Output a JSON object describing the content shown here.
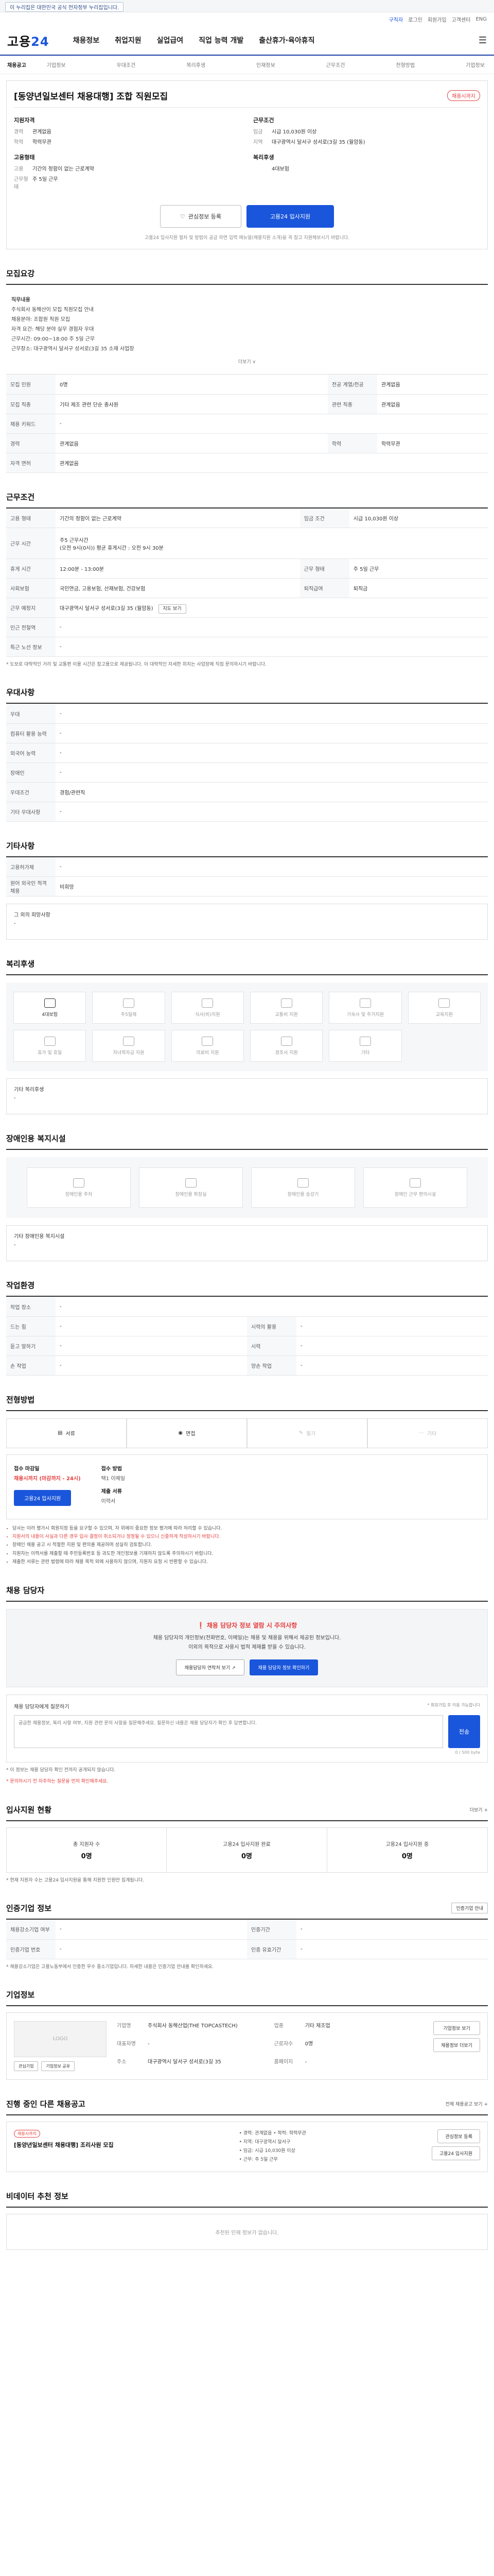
{
  "topbar": {
    "notice": "이 누리집은 대한민국 공식 전자정부 누리집입니다."
  },
  "util": {
    "items": [
      "로그인",
      "회원가입",
      "고객센터",
      "ENG"
    ],
    "highlight": "구직자"
  },
  "header": {
    "logo_main": "고용",
    "logo_accent": "24",
    "menu": [
      "채용정보",
      "취업지원",
      "실업급여",
      "직업 능력 개발",
      "출산휴가·육아휴직"
    ],
    "menu_icon": "☰"
  },
  "subnav": {
    "first": "채용공고",
    "items": [
      "기업정보",
      "우대조건",
      "복리후생",
      "인재정보",
      "근무조건",
      "전형방법",
      "기업정보"
    ]
  },
  "job": {
    "title": "[동양년일보센터 채용대행] 조합 직원모집",
    "status": "채용시까지",
    "summary": {
      "left_title": "지원자격",
      "left_rows": [
        [
          "경력",
          "관계없음"
        ],
        [
          "학력",
          "학력무관"
        ]
      ],
      "left2_title": "고용형태",
      "left2_rows": [
        [
          "고용",
          "기간의 정함이 없는 근로계약"
        ],
        [
          "근무형태",
          "주 5일 근무"
        ]
      ],
      "right_title": "근무조건",
      "right_rows": [
        [
          "임금",
          "시급 10,030원 이상"
        ],
        [
          "지역",
          "대구광역시 달서구 성서로(3길 35 (월암동)"
        ]
      ],
      "right2_title": "복리후생",
      "right2_rows": [
        [
          "",
          "4대보험"
        ]
      ]
    },
    "btn_scrap": "관심정보 등록",
    "btn_apply": "고용24 입사지원",
    "notice": "고용24 입사지원 절차 및 방법이 궁금 하면 입력 메뉴얼(채용지원 소개)을 꼭 참고 지원해보시기 바랍니다."
  },
  "sections": {
    "recruit": "모집요강",
    "work": "근무조건",
    "pref": "우대사항",
    "etc": "기타사항",
    "benefit": "복리후생",
    "disability": "장애인용 복지시설",
    "environment": "작업환경",
    "method": "전형방법",
    "contact": "채용 담당자",
    "stats": "입사지원 현황",
    "auth": "인증기업 정보",
    "company": "기업정보",
    "related": "진행 중인 다른 채용공고",
    "talent": "비데이터 추천 정보"
  },
  "recruit": {
    "desc_lines": [
      "직무내용",
      "주식회사 동해산이 모집 직원모집 안내",
      "채용분야: 조합원 직원 모집",
      "자격 요건: 해당 분야 실무 경험자 우대",
      "근무시간: 09:00~18:00 주 5일 근무",
      "근무장소: 대구광역시 달서구 성서로(3길 35 소재 사업장"
    ],
    "more": "더보기 ∨",
    "rows": [
      [
        [
          "모집 인원",
          "0명"
        ],
        [
          "전공 계열/전공",
          "관계없음"
        ]
      ],
      [
        [
          "모집 직종",
          "기타 제조 관련 단순 종사원"
        ],
        [
          "관련 직종",
          "관계없음"
        ]
      ],
      [
        [
          "채용 키워드",
          "-"
        ],
        [
          "",
          ""
        ]
      ],
      [
        [
          "경력",
          "관계없음"
        ],
        [
          "학력",
          "학력무관"
        ]
      ],
      [
        [
          "자격 면허",
          "관계없음"
        ],
        [
          "",
          ""
        ]
      ]
    ]
  },
  "work": {
    "rows": [
      [
        [
          "고용 형태",
          "기간의 정함이 없는 근로계약"
        ],
        [
          "임금 조건",
          "시급 10,030원 이상"
        ]
      ],
      [
        [
          "근무 시간",
          "주5 근무시간\n(오전 9시(0시)) 평균 휴게시간 : 오전 9시 30분"
        ],
        [
          "",
          ""
        ]
      ],
      [
        [
          "휴게 시간",
          "12:00분 - 13:00분"
        ],
        [
          "근무 형태",
          "주 5일 근무"
        ]
      ],
      [
        [
          "사회보험",
          "국민연금, 고용보험, 산재보험, 건강보험"
        ],
        [
          "퇴직급여",
          "퇴직금"
        ]
      ],
      [
        [
          "근무 예정지",
          "대구광역시 달서구 성서로(3길 35 (월암동)"
        ],
        [
          "",
          ""
        ]
      ],
      [
        [
          "인근 전철역",
          "-"
        ],
        [
          "",
          ""
        ]
      ],
      [
        [
          "특근 노선 정보",
          "-"
        ],
        [
          "",
          ""
        ]
      ]
    ],
    "map_btn": "지도 보기",
    "note": "* 도보로 대략적인 거리 및 교통편 이용 시간은 참고용으로 제공됩니다. 이 대략적인 자세한 위치는 사업장에 직접 문의하시기 바랍니다."
  },
  "pref": {
    "rows": [
      [
        "우대",
        "-"
      ],
      [
        "컴퓨터 활용 능력",
        "-"
      ],
      [
        "외국어 능력",
        "-"
      ],
      [
        "장애인",
        "-"
      ],
      [
        "우대조건",
        "경험/관련직"
      ],
      [
        "기타 우대사항",
        "-"
      ]
    ]
  },
  "etc": {
    "rows": [
      [
        "고용허가제",
        "-"
      ],
      [
        "원어 외국인 적격 채용",
        "비희망"
      ]
    ],
    "note_title": "그 외의 희망사항",
    "note_value": "-"
  },
  "benefit": {
    "items": [
      {
        "label": "4대보험",
        "on": true
      },
      {
        "label": "주5일제",
        "on": false
      },
      {
        "label": "식사(비)지원",
        "on": false
      },
      {
        "label": "교통비 지원",
        "on": false
      },
      {
        "label": "기숙사 및 주거지원",
        "on": false
      },
      {
        "label": "교육지원",
        "on": false
      },
      {
        "label": "휴가 및 휴일",
        "on": false
      },
      {
        "label": "자녀학자금 지원",
        "on": false
      },
      {
        "label": "의료비 지원",
        "on": false
      },
      {
        "label": "경조사 지원",
        "on": false
      },
      {
        "label": "기타",
        "on": false
      }
    ],
    "note_title": "기타 복리후생",
    "note_value": "-"
  },
  "disability": {
    "items": [
      "장애인용 주차",
      "장애인용 화장실",
      "장애인용 승강기",
      "장애인 근무 편의시설"
    ],
    "note_title": "기타 장애인용 복지시설",
    "note_value": "-"
  },
  "environment": {
    "rows": [
      [
        [
          "작업 장소",
          "-"
        ],
        [
          "",
          ""
        ]
      ],
      [
        [
          "드는 힘",
          "-"
        ],
        [
          "시력의 활용",
          "-"
        ]
      ],
      [
        [
          "듣고 말하기",
          "-"
        ],
        [
          "시력",
          "-"
        ]
      ],
      [
        [
          "손 작업",
          "-"
        ],
        [
          "양손 작업",
          "-"
        ]
      ]
    ]
  },
  "method": {
    "items": [
      {
        "label": "서류",
        "on": true
      },
      {
        "label": "면접",
        "on": true
      },
      {
        "label": "필기",
        "on": false
      },
      {
        "label": "기타",
        "on": false
      }
    ],
    "apply_title": "접수 마감일",
    "apply_value": "채용시까지 (마감까지 - 24시)",
    "apply_method_title": "접수 방법",
    "apply_method": "택1 이메일",
    "apply_doc_title": "제출 서류",
    "apply_doc": "이력서",
    "apply_btn": "고용24 입사지원",
    "bullets": [
      "당사는 이러 평가시 회원지정 등을 요구할 수 있으며, 자 위에이 중요한 정보 평가에 따라 처리할 수 있습니다.",
      "지원서의 내용이 사실과 다른 경우 입사 결정이 취소되거나 정정될 수 있으니 신중하게 작성하시기 바랍니다.",
      "장애인 채용 공고 시 적절한 지원 및 편의를 제공하며 성실히 검토합니다.",
      "지원자는 이력서를 제출할 때 주민등록번호 등 과도한 개인정보를 기재하지 않도록 주의하시기 바랍니다.",
      "제출한 서류는 관련 법령에 따라 채용 목적 외에 사용하지 않으며, 지원자 요청 시 반환할 수 있습니다."
    ]
  },
  "contact": {
    "banner_title": "❗ 채용 담당자 정보 열람 시 주의사항",
    "banner_text": "채용 담당자의 개인정보(전화번호, 이메일)는 채용 및 채용을 위해서 제공된 정보입니다.\n이외의 목적으로 사용시 법적 제재를 받을 수 있습니다.",
    "btn_view": "채용담당자 연락처 보기 ↗",
    "btn_confirm": "채용 담당자 정보 확인하기",
    "inquiry_title": "채용 담당자에게 질문하기",
    "inquiry_right": "* 회원가입 후 이용 가능합니다",
    "inquiry_placeholder": "궁금한 채용정보, 복리 사항 여부, 지원 관련 문의 사항을 질문해주세요. 질문하신 내용은 채용 담당자가 확인 후 답변합니다.",
    "inquiry_btn": "전송",
    "inquiry_count": "0 / 500 byte",
    "bullets": [
      "* 이 정보는 채용 담당자 확인 전까지 공개되지 않습니다.",
      "* 문의하시기 전 자주하는 질문을 먼저 확인해주세요."
    ]
  },
  "stats": {
    "right": "더보기 +",
    "items": [
      {
        "label": "총 지원자 수",
        "value": "0명"
      },
      {
        "label": "고용24 입사지원 완료",
        "value": "0명"
      },
      {
        "label": "고용24 입사지원 중",
        "value": "0명"
      }
    ],
    "note": "* 현재 지원자 수는 고용24 입사지원을 통해 지원한 인원만 집계됩니다."
  },
  "auth": {
    "right": "인증기업 안내",
    "rows": [
      [
        [
          "채용강소기업 여부",
          "-"
        ],
        [
          "인증기간",
          "-"
        ]
      ],
      [
        [
          "인증기업 번호",
          "-"
        ],
        [
          "인증 유효기간",
          "-"
        ]
      ]
    ],
    "note": "* 채용강소기업은 고용노동부에서 인증한 우수 중소기업입니다. 자세한 내용은 인증기업 안내를 확인하세요."
  },
  "company": {
    "logo_text": "LOGO",
    "mini_btns": [
      "관심기업",
      "기업정보 공유"
    ],
    "rows": [
      [
        "기업명",
        "주식회사 동해산업(THE TOPCASTECH)"
      ],
      [
        "업종",
        "기타 제조업"
      ],
      [
        "대표자명",
        "-"
      ],
      [
        "근로자수",
        "0명"
      ],
      [
        "주소",
        "대구광역시 달서구 성서로(3길 35"
      ],
      [
        "홈페이지",
        "-"
      ]
    ],
    "side_btns": [
      "기업정보 보기",
      "채용정보 더보기"
    ]
  },
  "related": {
    "right": "전체 채용공고 보기 +",
    "badge": "채용시까지",
    "title": "[동양년일보센터 채용대행] 조리사원 모집",
    "meta": [
      "• 경력: 관계없음 • 학력: 학력무관",
      "• 지역: 대구광역시 달서구",
      "• 임금: 시급 10,030원 이상",
      "• 근무: 주 5일 근무"
    ],
    "side": [
      "관심정보 등록",
      "고용24 입사지원"
    ]
  },
  "talent": {
    "empty": "추천된 인재 정보가 없습니다."
  }
}
